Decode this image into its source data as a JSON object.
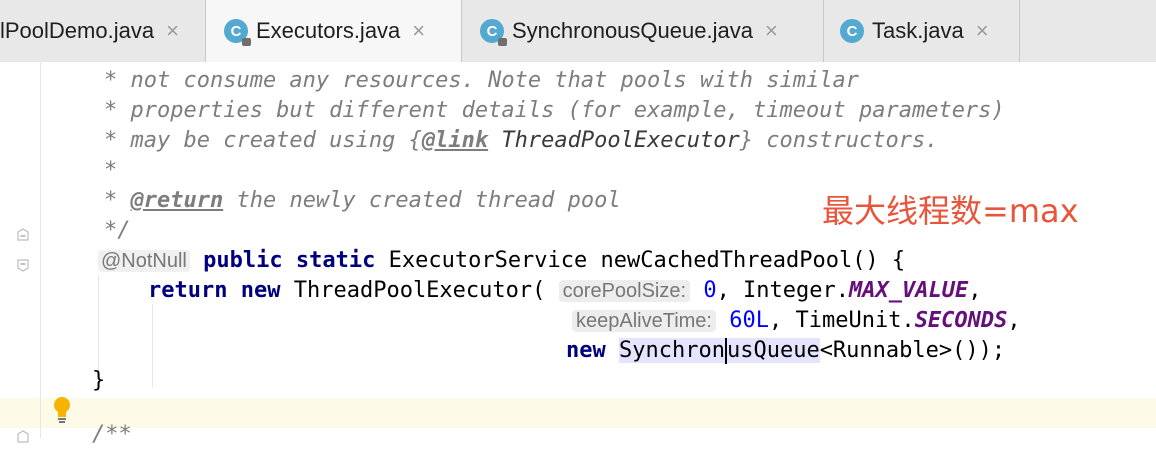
{
  "tabs": [
    {
      "label": "lPoolDemo.java",
      "close": "×",
      "active": false,
      "icon": "none"
    },
    {
      "label": "Executors.java",
      "close": "×",
      "active": true,
      "icon": "class-locked-icon"
    },
    {
      "label": "SynchronousQueue.java",
      "close": "×",
      "active": false,
      "icon": "class-locked-icon"
    },
    {
      "label": "Task.java",
      "close": "×",
      "active": false,
      "icon": "class-icon"
    }
  ],
  "class_icon_letter": "C",
  "code": {
    "l1": "* not consume any resources. Note that pools with similar",
    "l2": "* properties but different details (for example, timeout parameters)",
    "l3a": "* may be created using {",
    "l3tag": "@link",
    "l3b": " ThreadPoolExecutor",
    "l3c": "} constructors.",
    "l4": "*",
    "l5a": "* ",
    "l5tag": "@return",
    "l5b": " the newly created thread pool",
    "l6": "*/",
    "l7ann": "@NotNull",
    "l7kw1": "public",
    "l7kw2": "static",
    "l7rest": "ExecutorService newCachedThreadPool() {",
    "l8kw1": "return",
    "l8kw2": "new",
    "l8a": "ThreadPoolExecutor(",
    "l8hint": "corePoolSize:",
    "l8num": "0",
    "l8b": ", Integer.",
    "l8const": "MAX_VALUE",
    "l8c": ",",
    "l9hint": "keepAliveTime:",
    "l9num": "60L",
    "l9b": ", TimeUnit.",
    "l9const": "SECONDS",
    "l9c": ",",
    "l10kw": "new",
    "l10a": "Synchron",
    "l10b": "usQueue",
    "l10c": "<Runnable>());",
    "l11": "}",
    "l12": "/**"
  },
  "annotation_note": "最大线程数=max",
  "colors": {
    "keyword": "#00007f",
    "comment": "#7d7d7d",
    "number": "#0000ff",
    "constant": "#660e7a",
    "note": "#e8553a",
    "caret_row": "#fdfbe7"
  }
}
